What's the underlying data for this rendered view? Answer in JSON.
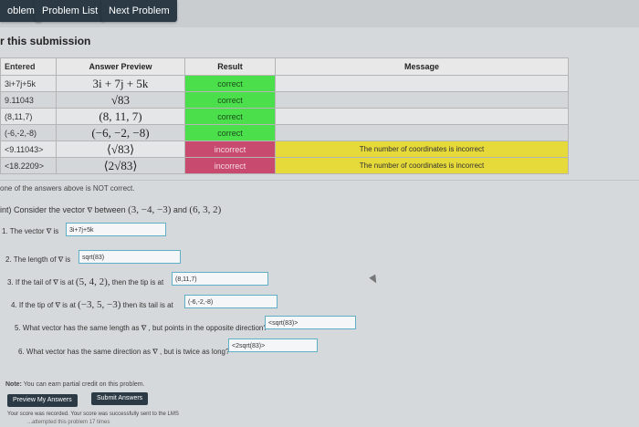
{
  "nav": {
    "problem_label": "oblem",
    "problem_list_label": "Problem List",
    "next_problem_label": "Next Problem"
  },
  "submission_title": "r this submission",
  "table": {
    "headers": {
      "entered": "Entered",
      "preview": "Answer Preview",
      "result": "Result",
      "message": "Message"
    },
    "rows": [
      {
        "entered": "3i+7j+5k",
        "preview": "3i + 7j + 5k",
        "result": "correct",
        "message": ""
      },
      {
        "entered": "9.11043",
        "preview": "√83",
        "result": "correct",
        "message": ""
      },
      {
        "entered": "(8,11,7)",
        "preview": "(8, 11, 7)",
        "result": "correct",
        "message": ""
      },
      {
        "entered": "(-6,-2,-8)",
        "preview": "(−6, −2, −8)",
        "result": "correct",
        "message": ""
      },
      {
        "entered": "<9.11043>",
        "preview": "⟨√83⟩",
        "result": "incorrect",
        "message": "The number of coordinates is incorrect"
      },
      {
        "entered": "<18.2209>",
        "preview": "⟨2√83⟩",
        "result": "incorrect",
        "message": "The number of coordinates is incorrect"
      }
    ]
  },
  "status_note": "one of the answers above is NOT correct.",
  "problem": {
    "prefix": "int) Consider the vector",
    "vector_symbol": "v̅",
    "between": "between",
    "point_a": "(3, −4, −3)",
    "and": "and",
    "point_b": "(6, 3, 2)"
  },
  "questions": [
    {
      "num": "1.",
      "text_a": "The vector",
      "sym": "v̅",
      "text_b": "is",
      "answer": "3i+7j+5k"
    },
    {
      "num": "2.",
      "text_a": "The length of",
      "sym": "v̅",
      "text_b": "is",
      "answer": "sqrt(83)"
    },
    {
      "num": "3.",
      "text_a": "If the tail of",
      "sym": "v̅",
      "text_b": "is at",
      "math": "(5, 4, 2),",
      "text_c": "then the tip is at",
      "answer": "(8,11,7)"
    },
    {
      "num": "4.",
      "text_a": "If the tip of",
      "sym": "v̅",
      "text_b": "is at",
      "math": "(−3, 5, −3)",
      "text_c": "then its tail is at",
      "answer": "(-6,-2,-8)"
    },
    {
      "num": "5.",
      "text_a": "What vector has the same length as",
      "sym": "v̅",
      "text_b": ", but points in the opposite direction?",
      "answer": "<sqrt(83)>"
    },
    {
      "num": "6.",
      "text_a": "What vector has the same direction as",
      "sym": "v̅",
      "text_b": ", but is twice as long?",
      "answer": "<2sqrt(83)>"
    }
  ],
  "note_label": "Note:",
  "note_text": "You can earn partial credit on this problem.",
  "buttons": {
    "preview": "Preview My Answers",
    "submit": "Submit Answers"
  },
  "footer_line1": "Your score was recorded. Your score was successfully sent to the LMS",
  "footer_line2": "...attempted this problem 17 times"
}
